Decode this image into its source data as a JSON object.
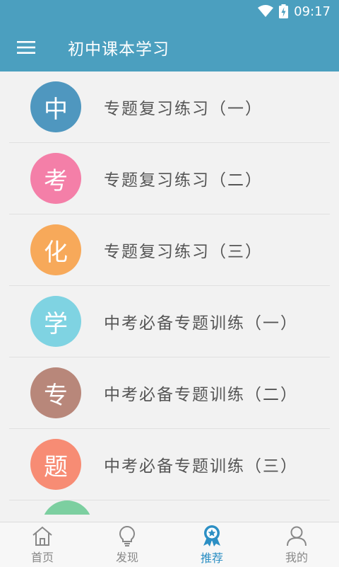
{
  "status": {
    "time": "09:17",
    "wifi_icon": "wifi-icon",
    "battery_icon": "battery-charging-icon"
  },
  "app_bar": {
    "menu_icon": "hamburger-menu-icon",
    "title": "初中课本学习"
  },
  "list": {
    "items": [
      {
        "badge": "中",
        "label": "专题复习练习（一）",
        "color": "#4f97bf"
      },
      {
        "badge": "考",
        "label": "专题复习练习（二）",
        "color": "#f47fa8"
      },
      {
        "badge": "化",
        "label": "专题复习练习（三）",
        "color": "#f7a95a"
      },
      {
        "badge": "学",
        "label": "中考必备专题训练（一）",
        "color": "#7fd3e2"
      },
      {
        "badge": "专",
        "label": "中考必备专题训练（二）",
        "color": "#b8877a"
      },
      {
        "badge": "题",
        "label": "中考必备专题训练（三）",
        "color": "#f78c74"
      }
    ],
    "partial_item_color": "#7ccfa0"
  },
  "bottom_nav": {
    "tabs": [
      {
        "label": "首页",
        "icon": "home-icon"
      },
      {
        "label": "发现",
        "icon": "lightbulb-icon"
      },
      {
        "label": "推荐",
        "icon": "ribbon-star-icon",
        "active": true
      },
      {
        "label": "我的",
        "icon": "user-icon"
      }
    ],
    "active_color": "#2c8fc4",
    "inactive_color": "#888888"
  }
}
